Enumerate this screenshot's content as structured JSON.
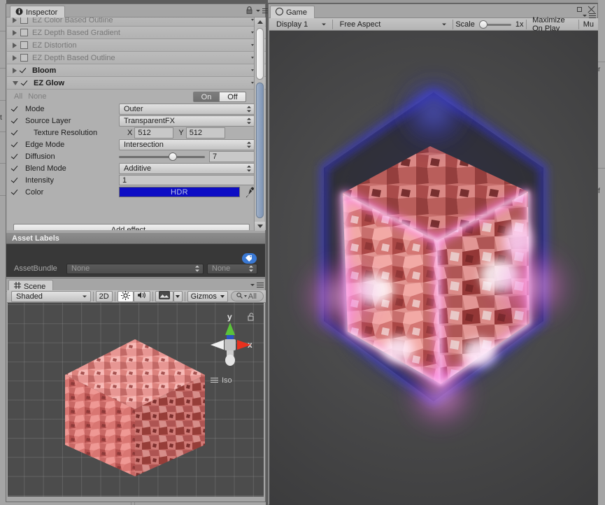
{
  "inspector": {
    "tab_label": "Inspector",
    "tab_icon": "info-icon",
    "lock_icon": "lock-icon",
    "menu_icon": "hamburger-menu-icon",
    "effects": [
      {
        "name": "EZ Color Based Outline",
        "enabled": false,
        "expanded": false
      },
      {
        "name": "EZ Depth Based Gradient",
        "enabled": false,
        "expanded": false
      },
      {
        "name": "EZ Distortion",
        "enabled": false,
        "expanded": false
      },
      {
        "name": "EZ Depth Based Outline",
        "enabled": false,
        "expanded": false
      },
      {
        "name": "Bloom",
        "enabled": true,
        "expanded": false
      },
      {
        "name": "EZ Glow",
        "enabled": true,
        "expanded": true
      }
    ],
    "glow": {
      "all_label": "All",
      "none_label": "None",
      "on_label": "On",
      "off_label": "Off",
      "mode_label": "Mode",
      "mode_value": "Outer",
      "source_layer_label": "Source Layer",
      "source_layer_value": "TransparentFX",
      "texture_resolution_label": "Texture Resolution",
      "texture_res_x_label": "X",
      "texture_res_x": "512",
      "texture_res_y_label": "Y",
      "texture_res_y": "512",
      "edge_mode_label": "Edge Mode",
      "edge_mode_value": "Intersection",
      "diffusion_label": "Diffusion",
      "diffusion_value": "7",
      "blend_mode_label": "Blend Mode",
      "blend_mode_value": "Additive",
      "intensity_label": "Intensity",
      "intensity_value": "1",
      "color_label": "Color",
      "color_badge": "HDR",
      "color_hex": "#0d0dc4",
      "eyedropper_icon": "eyedropper-icon"
    },
    "add_effect_label": "Add effect..."
  },
  "asset_labels": {
    "header": "Asset Labels",
    "tag_icon": "tag-icon",
    "bundle_label": "AssetBundle",
    "bundle_value": "None",
    "variant_value": "None"
  },
  "scene": {
    "tab_label": "Scene",
    "tab_icon": "grid-icon",
    "menu_icon": "hamburger-menu-icon",
    "draw_mode": "Shaded",
    "mode_2d": "2D",
    "lighting_icon": "sun-icon",
    "audio_icon": "speaker-icon",
    "fx_icon": "image-icon",
    "gizmos_label": "Gizmos",
    "search_placeholder": "All",
    "search_icon": "search-icon",
    "gizmo": {
      "x_label": "x",
      "y_label": "y",
      "projection_label": "Iso",
      "lock_icon": "unlock-icon"
    }
  },
  "game": {
    "tab_label": "Game",
    "tab_icon": "game-icon",
    "display_value": "Display 1",
    "aspect_value": "Free Aspect",
    "scale_label": "Scale",
    "scale_value": "1x",
    "maximize_label": "Maximize On Play",
    "mute_label": "Mu",
    "minimize_icon": "restore-window-icon",
    "close_icon": "close-icon",
    "menu_icon": "hamburger-menu-icon"
  }
}
